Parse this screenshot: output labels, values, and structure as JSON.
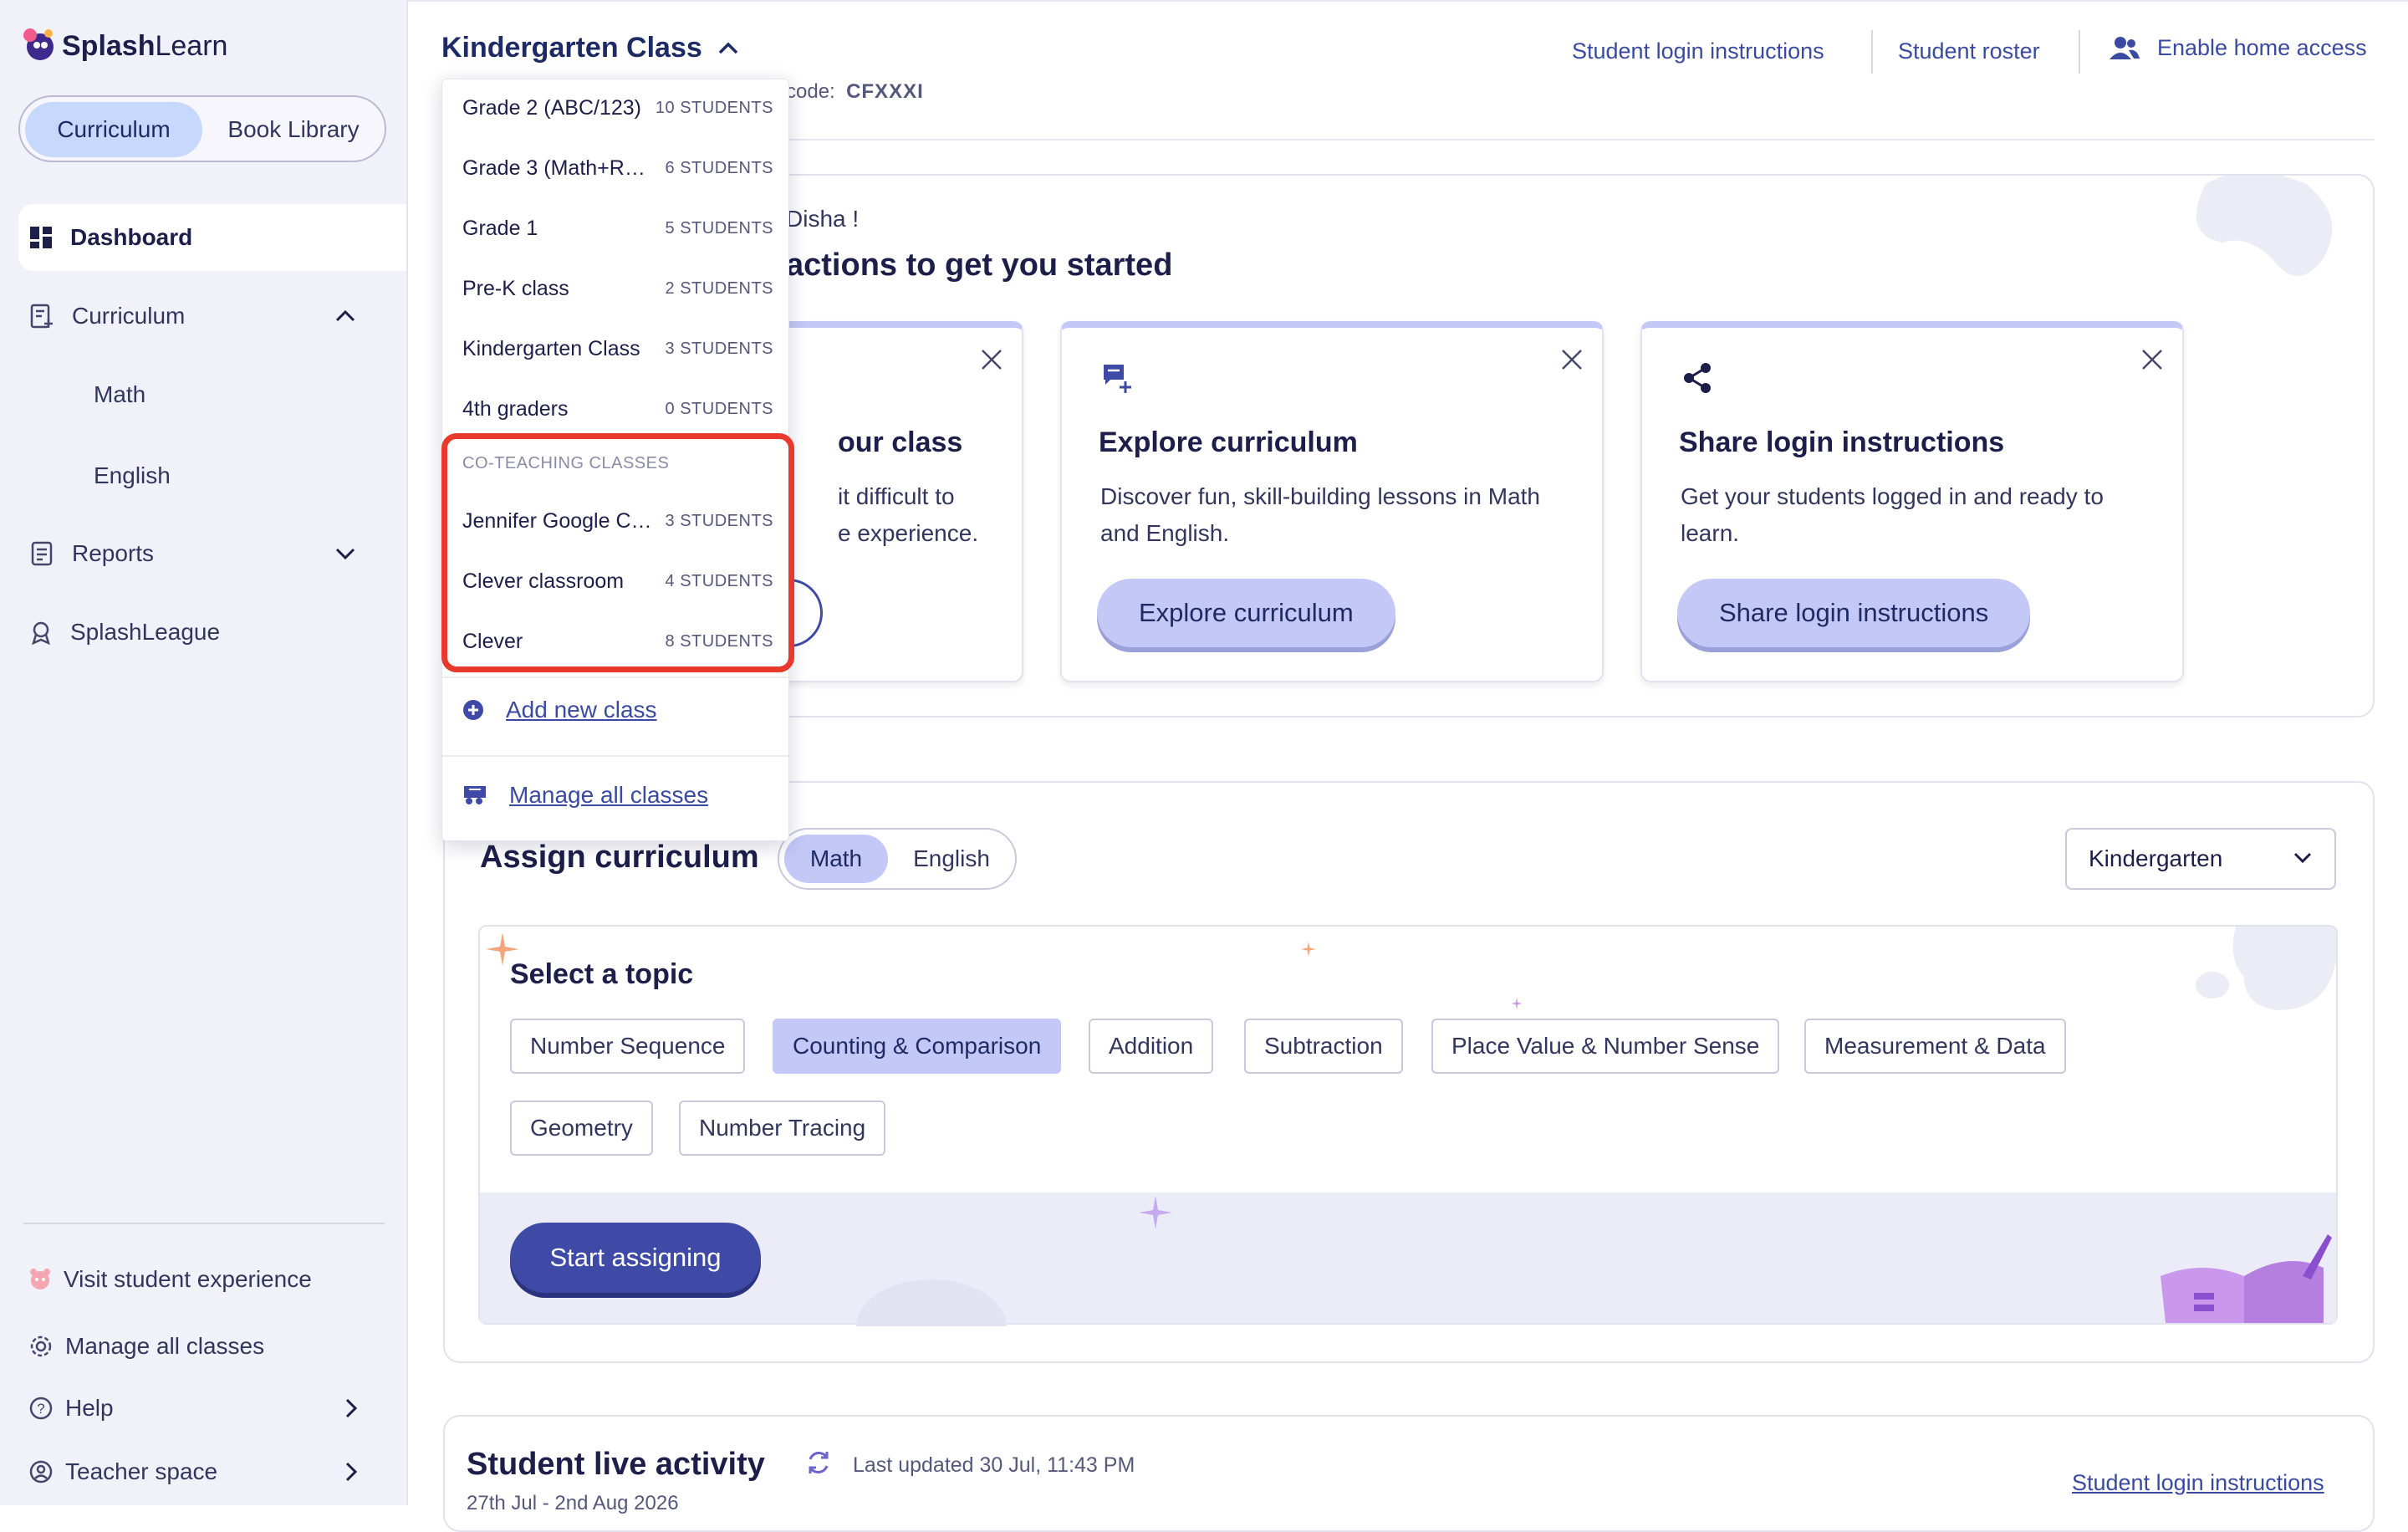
{
  "brand": {
    "name_bold": "Splash",
    "name_rest": "Learn"
  },
  "sidebar": {
    "toggle": {
      "active": "Curriculum",
      "inactive": "Book Library"
    },
    "nav": {
      "dashboard": "Dashboard",
      "curriculum": "Curriculum",
      "math": "Math",
      "english": "English",
      "reports": "Reports",
      "splashleague": "SplashLeague"
    },
    "bottom": {
      "visit": "Visit student experience",
      "manage": "Manage all classes",
      "help": "Help",
      "teacher_space": "Teacher space"
    }
  },
  "header": {
    "class_title": "Kindergarten Class",
    "code_label": "code:",
    "code_value": "CFXXXI",
    "links": {
      "login_instructions": "Student login instructions",
      "roster": "Student roster",
      "home_access": "Enable home access"
    }
  },
  "welcome": {
    "greeting": "Disha !",
    "heading": "actions to get you started",
    "cards": [
      {
        "title": "our class",
        "desc1": "it difficult to",
        "desc2": "e experience."
      },
      {
        "title": "Explore curriculum",
        "desc1": "Discover fun, skill-building lessons in Math",
        "desc2": "and English.",
        "button": "Explore curriculum"
      },
      {
        "title": "Share login instructions",
        "desc1": "Get your students logged in and ready to",
        "desc2": "learn.",
        "button": "Share login instructions"
      }
    ]
  },
  "assign": {
    "title": "Assign curriculum",
    "subjects": {
      "active": "Math",
      "inactive": "English"
    },
    "grade": "Kindergarten",
    "topic_title": "Select a topic",
    "topics": [
      "Number Sequence",
      "Counting & Comparison",
      "Addition",
      "Subtraction",
      "Place Value & Number Sense",
      "Measurement & Data",
      "Geometry",
      "Number Tracing"
    ],
    "active_topic": "Counting & Comparison",
    "start_button": "Start assigning"
  },
  "live": {
    "title": "Student live activity",
    "updated": "Last updated 30 Jul, 11:43 PM",
    "link": "Student login instructions",
    "date_range": "27th Jul - 2nd Aug 2026"
  },
  "dropdown": {
    "classes": [
      {
        "name": "Grade 2 (ABC/123)",
        "count": "10 STUDENTS"
      },
      {
        "name": "Grade 3 (Math+R…",
        "count": "6 STUDENTS"
      },
      {
        "name": "Grade 1",
        "count": "5 STUDENTS"
      },
      {
        "name": "Pre-K class",
        "count": "2 STUDENTS"
      },
      {
        "name": "Kindergarten Class",
        "count": "3 STUDENTS"
      },
      {
        "name": "4th graders",
        "count": "0 STUDENTS"
      }
    ],
    "coteaching_heading": "CO-TEACHING CLASSES",
    "coteaching": [
      {
        "name": "Jennifer Google C…",
        "count": "3 STUDENTS"
      },
      {
        "name": "Clever classroom",
        "count": "4 STUDENTS"
      },
      {
        "name": "Clever",
        "count": "8 STUDENTS"
      }
    ],
    "add_new": "Add new class",
    "manage_all": "Manage all classes"
  },
  "colors": {
    "accent": "#3f4aa6",
    "highlight": "#e83a2c",
    "lavender": "#c4c8f6",
    "sidebar_bg": "#f1f1fa"
  }
}
